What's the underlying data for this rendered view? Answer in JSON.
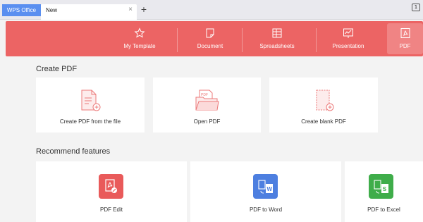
{
  "tabs": {
    "app_tab": "WPS Office",
    "doc_tab": "New",
    "close_glyph": "×",
    "add_glyph": "+",
    "window_badge": "1"
  },
  "header": {
    "accent_color": "#ec6464",
    "items": [
      {
        "label": "My Template",
        "icon": "star-icon"
      },
      {
        "label": "Document",
        "icon": "document-icon"
      },
      {
        "label": "Spreadsheets",
        "icon": "spreadsheet-icon"
      },
      {
        "label": "Presentation",
        "icon": "presentation-icon"
      },
      {
        "label": "PDF",
        "icon": "pdf-icon",
        "active": true
      }
    ]
  },
  "create_pdf": {
    "title": "Create PDF",
    "cards": [
      {
        "label": "Create PDF from the file",
        "icon": "file-add-icon"
      },
      {
        "label": "Open PDF",
        "icon": "folder-pdf-icon"
      },
      {
        "label": "Create blank PDF",
        "icon": "blank-page-add-icon"
      }
    ]
  },
  "recommend": {
    "title": "Recommend features",
    "cards": [
      {
        "label": "PDF Edit",
        "icon": "pdf-edit-icon",
        "color": "#e95a5a"
      },
      {
        "label": "PDF to Word",
        "icon": "pdf-to-word-icon",
        "color": "#4d7fe0"
      },
      {
        "label": "PDF to Excel",
        "icon": "pdf-to-excel-icon",
        "color": "#3fad4a"
      }
    ]
  }
}
